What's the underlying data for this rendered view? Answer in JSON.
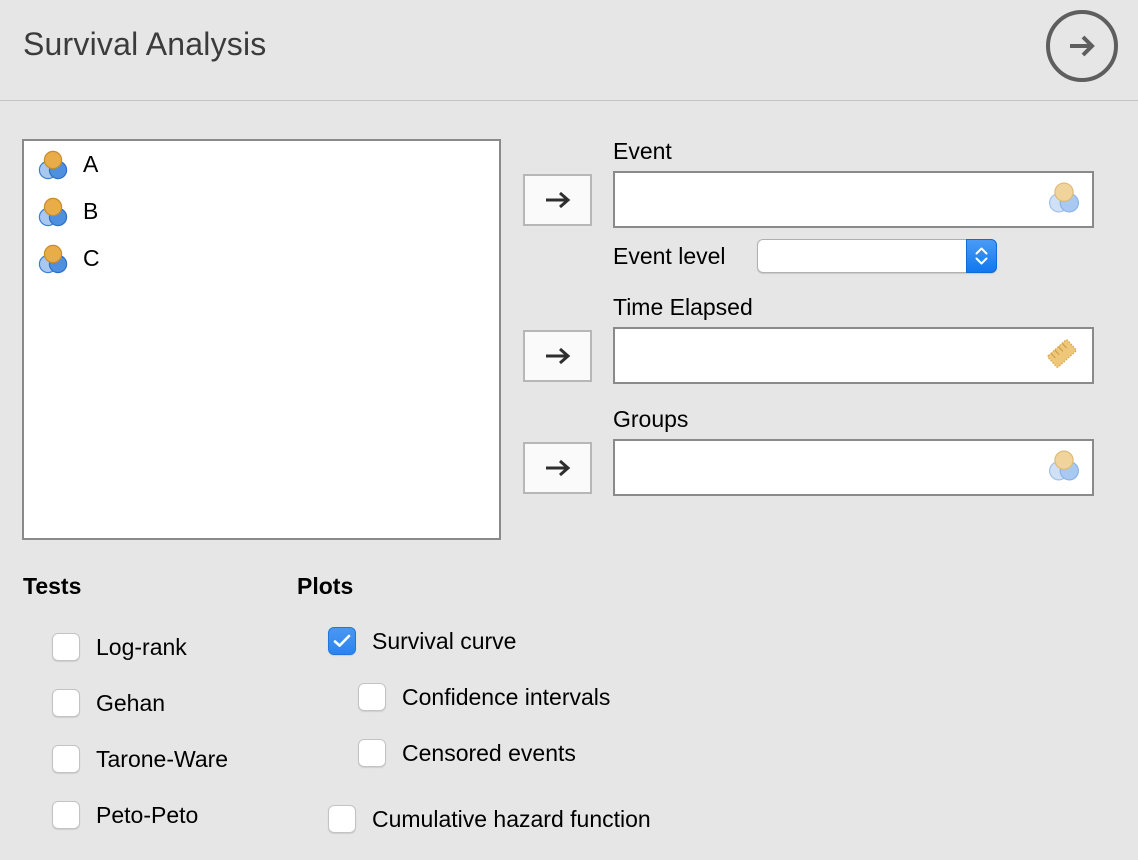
{
  "header": {
    "title": "Survival Analysis",
    "run_button_icon": "arrow-right-circle-icon"
  },
  "variable_list": {
    "items": [
      {
        "label": "A",
        "icon": "nominal-variable-icon"
      },
      {
        "label": "B",
        "icon": "nominal-variable-icon"
      },
      {
        "label": "C",
        "icon": "nominal-variable-icon"
      }
    ]
  },
  "fields": {
    "event": {
      "label": "Event",
      "value": "",
      "transfer_button_icon": "arrow-right-icon",
      "hint_icon": "nominal-variable-icon"
    },
    "event_level": {
      "label": "Event level",
      "value": "",
      "stepper_icon": "chevron-up-down-icon"
    },
    "time_elapsed": {
      "label": "Time Elapsed",
      "value": "",
      "transfer_button_icon": "arrow-right-icon",
      "hint_icon": "ruler-icon"
    },
    "groups": {
      "label": "Groups",
      "value": "",
      "transfer_button_icon": "arrow-right-icon",
      "hint_icon": "nominal-variable-icon"
    }
  },
  "tests": {
    "title": "Tests",
    "options": [
      {
        "label": "Log-rank",
        "checked": false
      },
      {
        "label": "Gehan",
        "checked": false
      },
      {
        "label": "Tarone-Ware",
        "checked": false
      },
      {
        "label": "Peto-Peto",
        "checked": false
      }
    ]
  },
  "plots": {
    "title": "Plots",
    "options": [
      {
        "label": "Survival curve",
        "checked": true
      },
      {
        "label": "Confidence intervals",
        "checked": false
      },
      {
        "label": "Censored events",
        "checked": false
      },
      {
        "label": "Cumulative hazard function",
        "checked": false
      }
    ]
  },
  "colors": {
    "background": "#e6e6e6",
    "accent_blue": "#2a84ec",
    "icon_orange": "#e8ad48",
    "icon_blue_light": "#a9c8f0",
    "icon_blue_dark": "#4e8fe0",
    "ruler_gold": "#eec77a",
    "title_gray": "#3b3b3b",
    "border_gray": "#8a8a8a"
  }
}
